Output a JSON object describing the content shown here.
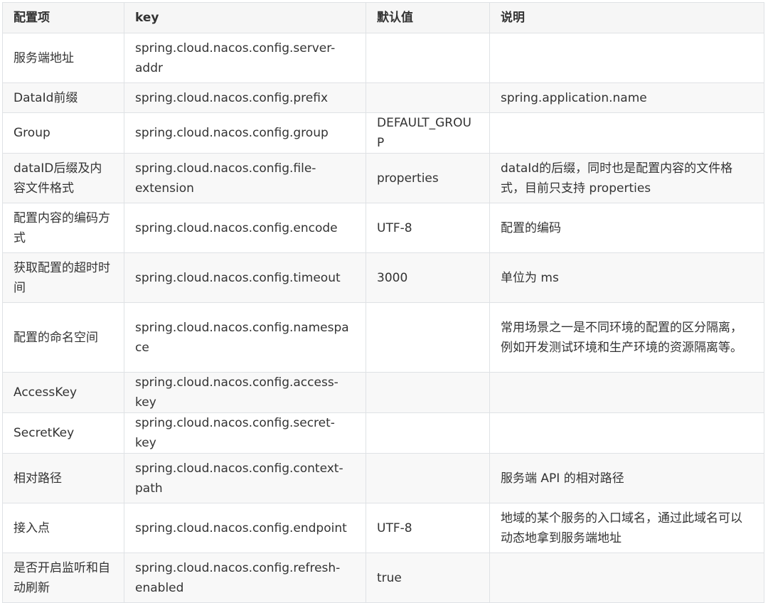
{
  "table": {
    "headers": [
      "配置项",
      "key",
      "默认值",
      "说明"
    ],
    "rows": [
      [
        "服务端地址",
        "spring.cloud.nacos.config.server-addr",
        "",
        ""
      ],
      [
        "DataId前缀",
        "spring.cloud.nacos.config.prefix",
        "",
        "spring.application.name"
      ],
      [
        "Group",
        "spring.cloud.nacos.config.group",
        "DEFAULT_GROUP",
        ""
      ],
      [
        "dataID后缀及内容文件格式",
        "spring.cloud.nacos.config.file-extension",
        "properties",
        "dataId的后缀，同时也是配置内容的文件格式，目前只支持 properties"
      ],
      [
        "配置内容的编码方式",
        "spring.cloud.nacos.config.encode",
        "UTF-8",
        "配置的编码"
      ],
      [
        "获取配置的超时时间",
        "spring.cloud.nacos.config.timeout",
        "3000",
        "单位为 ms"
      ],
      [
        "配置的命名空间",
        "spring.cloud.nacos.config.namespace",
        "",
        "常用场景之一是不同环境的配置的区分隔离，例如开发测试环境和生产环境的资源隔离等。"
      ],
      [
        "AccessKey",
        "spring.cloud.nacos.config.access-key",
        "",
        ""
      ],
      [
        "SecretKey",
        "spring.cloud.nacos.config.secret-key",
        "",
        ""
      ],
      [
        "相对路径",
        "spring.cloud.nacos.config.context-path",
        "",
        "服务端 API 的相对路径"
      ],
      [
        "接入点",
        "spring.cloud.nacos.config.endpoint",
        "UTF-8",
        "地域的某个服务的入口域名，通过此域名可以动态地拿到服务端地址"
      ],
      [
        "是否开启监听和自动刷新",
        "spring.cloud.nacos.config.refresh-enabled",
        "true",
        ""
      ]
    ]
  }
}
